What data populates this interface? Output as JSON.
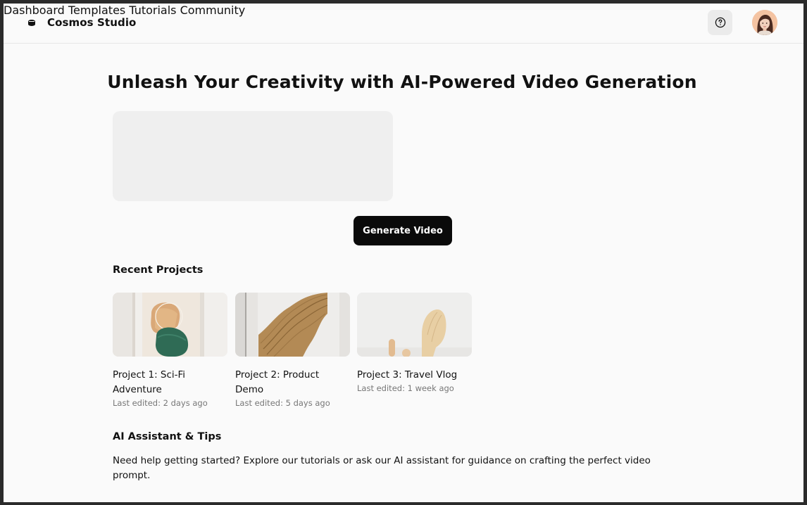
{
  "app": {
    "name": "Cosmos Studio",
    "logo_icon": "database-icon"
  },
  "nav": {
    "items": [
      {
        "label": "Dashboard"
      },
      {
        "label": "Templates"
      },
      {
        "label": "Tutorials"
      },
      {
        "label": "Community"
      }
    ],
    "help_icon": "question-circle-icon",
    "avatar": "user-avatar"
  },
  "hero": {
    "title": "Unleash Your Creativity with AI-Powered Video Generation",
    "prompt_value": "",
    "generate_label": "Generate Video"
  },
  "recent": {
    "title": "Recent Projects",
    "projects": [
      {
        "title": "Project 1: Sci-Fi Adventure",
        "meta": "Last edited: 2 days ago"
      },
      {
        "title": "Project 2: Product Demo",
        "meta": "Last edited: 5 days ago"
      },
      {
        "title": "Project 3: Travel Vlog",
        "meta": "Last edited: 1 week ago"
      }
    ]
  },
  "assistant": {
    "title": "AI Assistant & Tips",
    "text": "Need help getting started? Explore our tutorials or ask our AI assistant for guidance on crafting the perfect video prompt."
  },
  "colors": {
    "accent": "#0a0a0a",
    "background": "#fafafa",
    "muted": "#777777"
  }
}
